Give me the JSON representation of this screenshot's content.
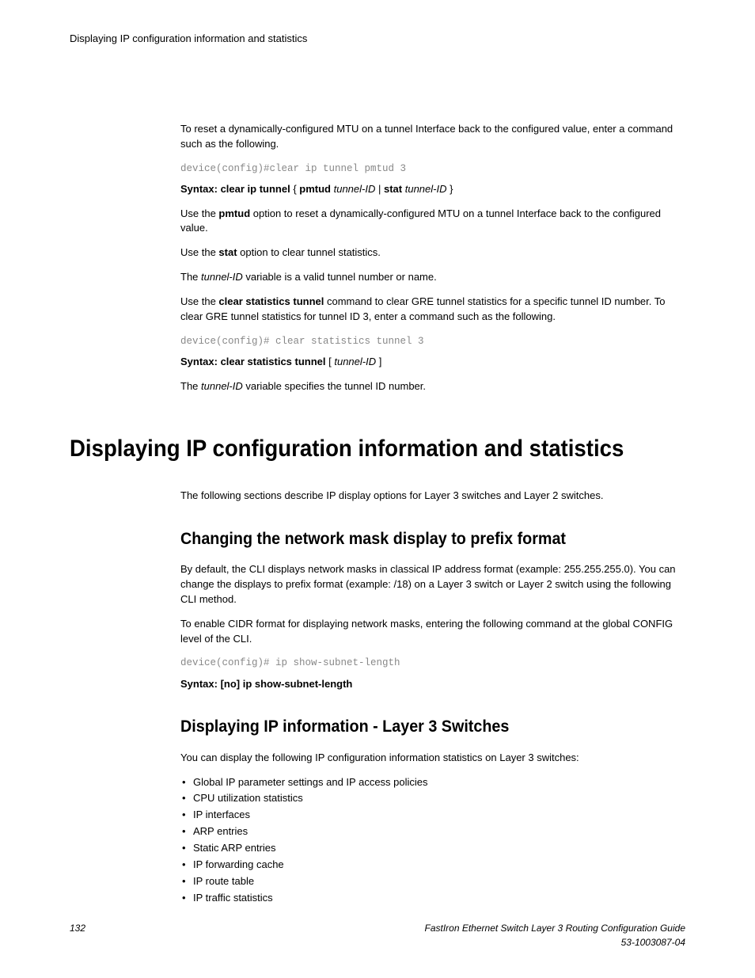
{
  "header": {
    "running": "Displaying IP configuration information and statistics"
  },
  "body": {
    "p_intro": "To reset a dynamically-configured MTU on a tunnel Interface back to the configured value, enter a command such as the following.",
    "code1": "device(config)#clear ip tunnel pmtud 3",
    "syntax1": {
      "prefix": "Syntax: clear ip tunnel",
      "brace_open": " { ",
      "opt1_b": "pmtud",
      "opt1_i": " tunnel-ID",
      "sep": " | ",
      "opt2_b": "stat",
      "opt2_i": " tunnel-ID",
      "brace_close": " }"
    },
    "p_pmtud_a": "Use the ",
    "p_pmtud_b": "pmtud",
    "p_pmtud_c": " option to reset a dynamically-configured MTU on a tunnel Interface back to the configured value.",
    "p_stat_a": "Use the ",
    "p_stat_b": "stat",
    "p_stat_c": " option to clear tunnel statistics.",
    "p_tid1_a": "The ",
    "p_tid1_b": "tunnel-ID",
    "p_tid1_c": " variable is a valid tunnel number or name.",
    "p_clear_a": "Use the ",
    "p_clear_b": "clear statistics tunnel",
    "p_clear_c": " command to clear GRE tunnel statistics for a specific tunnel ID number. To clear GRE tunnel statistics for tunnel ID 3, enter a command such as the following.",
    "code2": "device(config)# clear statistics tunnel 3",
    "syntax2": {
      "prefix": "Syntax: clear statistics tunnel",
      "bracket_open": " [ ",
      "arg_i": "tunnel-ID",
      "bracket_close": " ]"
    },
    "p_tid2_a": "The ",
    "p_tid2_b": "tunnel-ID",
    "p_tid2_c": " variable specifies the tunnel ID number."
  },
  "h1": "Displaying IP configuration information and statistics",
  "h1_p": "The following sections describe IP display options for Layer 3 switches and Layer 2 switches.",
  "h2a": "Changing the network mask display to prefix format",
  "sec_a": {
    "p1": "By default, the CLI displays network masks in classical IP address format (example: 255.255.255.0). You can change the displays to prefix format (example: /18) on a Layer 3 switch or Layer 2 switch using the following CLI method.",
    "p2": "To enable CIDR format for displaying network masks, entering the following command at the global CONFIG level of the CLI.",
    "code": "device(config)# ip show-subnet-length",
    "syntax": "Syntax: [no] ip show-subnet-length"
  },
  "h2b": "Displaying IP information - Layer 3 Switches",
  "sec_b": {
    "p1": "You can display the following IP configuration information statistics on Layer 3 switches:",
    "items": [
      "Global IP parameter settings and IP access policies",
      "CPU utilization statistics",
      "IP interfaces",
      "ARP entries",
      "Static ARP entries",
      "IP forwarding cache",
      "IP route table",
      "IP traffic statistics"
    ]
  },
  "footer": {
    "page": "132",
    "title": "FastIron Ethernet Switch Layer 3 Routing Configuration Guide",
    "docnum": "53-1003087-04"
  }
}
